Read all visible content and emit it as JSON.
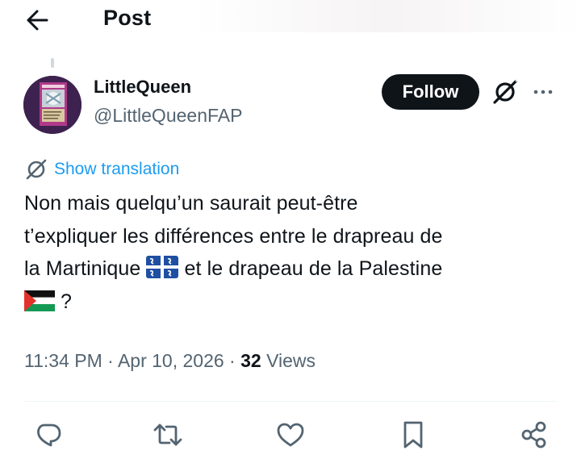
{
  "header": {
    "title": "Post"
  },
  "post": {
    "author": {
      "name": "LittleQueen",
      "handle": "@LittleQueenFAP"
    },
    "follow_label": "Follow",
    "translate_label": "Show translation",
    "text": {
      "line1": "Non mais quelqu’un saurait peut-être",
      "line2": "t’expliquer les différences entre le drapreau de",
      "line3a": "la Martinique",
      "line3b": "et le drapeau de la Palestine",
      "line4": "?"
    },
    "meta": {
      "time": "11:34 PM",
      "separator": "·",
      "date": "Apr 10, 2026",
      "views_count": "32",
      "views_label": "Views"
    }
  },
  "icons": {
    "back": "arrow-left-icon",
    "grok": "grok-icon",
    "more": "more-icon",
    "translate": "translate-globe-icon",
    "flag_martinique": "martinique-flag",
    "flag_palestine": "palestine-flag",
    "reply": "reply-icon",
    "repost": "repost-icon",
    "like": "like-icon",
    "bookmark": "bookmark-icon",
    "share": "share-icon"
  },
  "colors": {
    "text": "#0f1419",
    "secondary": "#536471",
    "link": "#1d9bf0",
    "follow_bg": "#0f1419",
    "divider": "#eff3f4"
  }
}
